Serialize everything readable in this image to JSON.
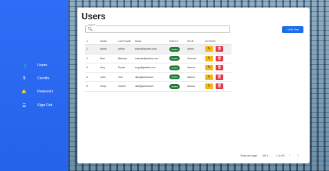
{
  "sidebar": {
    "items": [
      {
        "label": "Users",
        "icon": "users-icon",
        "glyph": "👥"
      },
      {
        "label": "Credits",
        "icon": "dollar-icon",
        "glyph": "$"
      },
      {
        "label": "Requests",
        "icon": "bell-icon",
        "glyph": "🔔"
      },
      {
        "label": "Sign Out",
        "icon": "sliders-icon",
        "glyph": "☰"
      }
    ]
  },
  "main": {
    "title": "Users",
    "search": {
      "label": "Search",
      "value": ""
    },
    "add_button": "+ Add User"
  },
  "table": {
    "headers": [
      "#",
      "NAME",
      "LAST NAME",
      "EMAIL",
      "STATUS",
      "ROLE",
      "ACTIONS"
    ],
    "rows": [
      {
        "id": "1",
        "name": "admin",
        "last": "admin",
        "email": "admin@access.com",
        "status": "Active",
        "role": "Admin"
      },
      {
        "id": "2",
        "name": "Mae",
        "last": "Beknam",
        "email": "maebek@jazeka.com",
        "status": "Active",
        "role": "Gerente"
      },
      {
        "id": "3",
        "name": "Amy",
        "last": "Purple",
        "email": "amyp@jazeka.com",
        "status": "Active",
        "role": "Asesor"
      },
      {
        "id": "4",
        "name": "John",
        "last": "Vick",
        "email": "vick@jazeka.com",
        "status": "Active",
        "role": "Asesor"
      },
      {
        "id": "5",
        "name": "Vicky",
        "last": "Vonker",
        "email": "vick@jazeka.com",
        "status": "Active",
        "role": "Asesor"
      }
    ]
  },
  "pagination": {
    "rows_per_page_label": "Rows per page:",
    "rows_per_page_value": "100 ▾",
    "range": "1–5 of 5",
    "prev": "‹",
    "next": "›"
  },
  "colors": {
    "sidebar": "#2563eb",
    "status_active": "#1f7a35",
    "edit": "#f5b819",
    "delete": "#e0394a",
    "primary": "#1c6ee8"
  }
}
